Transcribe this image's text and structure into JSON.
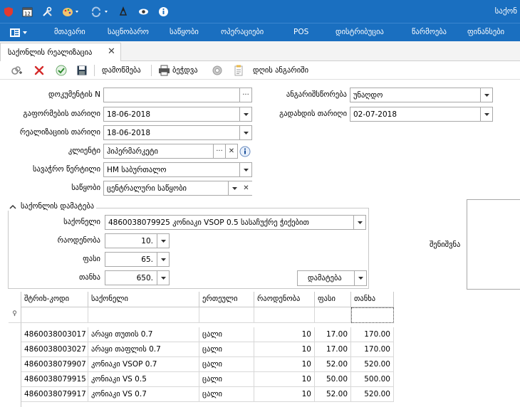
{
  "app": {
    "title": "საქონ"
  },
  "menu": {
    "items": [
      "მთავარი",
      "საცნობარო",
      "საწყობი",
      "ოპერაციები",
      "POS",
      "დისტრიბუცია",
      "წარმოება",
      "ფინანსები"
    ]
  },
  "tab": {
    "label": "საქონლის რეალიზაცია",
    "close": "✕"
  },
  "toolbar": {
    "confirm_label": "დამოწმება",
    "print_label": "ბეჭდვა",
    "report_label": "დღის ანგარიში"
  },
  "form": {
    "doc_number": {
      "label": "დოკუმენტის N",
      "value": "",
      "btn": "···"
    },
    "account_type": {
      "label": "ანგარიშსწორება",
      "value": "უნაღდო"
    },
    "issue_date": {
      "label": "გაფორმების თარიღი",
      "value": "18-06-2018"
    },
    "pay_date": {
      "label": "გადახდის თარიღი",
      "value": "02-07-2018"
    },
    "sale_date": {
      "label": "რეალიზაციის თარიღი",
      "value": "18-06-2018"
    },
    "client": {
      "label": "კლიენტი",
      "value": "ჰიპერმარკეტი",
      "btn": "···",
      "clear": "✕"
    },
    "price_list": {
      "label": "სავაჭრო წერტილი",
      "value": "HM საბურთალო"
    },
    "warehouse": {
      "label": "საწყობი",
      "value": "ცენტრალური საწყობი",
      "clear": "✕"
    }
  },
  "add_group": {
    "title": "საქონლის დამატება",
    "product": {
      "label": "საქონელი",
      "value": "4860038079925  კონიაკი VSOP 0.5 სასაჩუქრე ჭიქებით"
    },
    "quantity": {
      "label": "რაოდენობა",
      "value": "10."
    },
    "price": {
      "label": "ფასი",
      "value": "65."
    },
    "amount": {
      "label": "თანხა",
      "value": "650."
    },
    "add_button": "დამატება"
  },
  "notes": {
    "label": "შენიშვნა"
  },
  "grid": {
    "columns": [
      "შტრიხ-კოდი",
      "საქონელი",
      "ერთეული",
      "რაოდენობა",
      "ფასი",
      "თანხა"
    ],
    "filter_icon": "♀",
    "rows": [
      [
        "4860038003017",
        "არაყი თუთის 0.7",
        "ცალი",
        "10",
        "17.00",
        "170.00"
      ],
      [
        "4860038003027",
        "არაყი თაფლის 0.7",
        "ცალი",
        "10",
        "17.00",
        "170.00"
      ],
      [
        "4860038079907",
        "კონიაკი VSOP 0.7",
        "ცალი",
        "10",
        "52.00",
        "520.00"
      ],
      [
        "4860038079915",
        "კონიაკი VS 0.5",
        "ცალი",
        "10",
        "50.00",
        "500.00"
      ],
      [
        "4860038079917",
        "კონიაკი VS 0.7",
        "ცალი",
        "10",
        "52.00",
        "520.00"
      ]
    ]
  },
  "colors": {
    "accent": "#1a6fc0",
    "grid_line": "#d8d8d8"
  },
  "icons": [
    "shield-icon",
    "calendar-icon",
    "tools-icon",
    "palette-icon",
    "sync-icon",
    "user-icon",
    "eye-icon",
    "info-icon",
    "menu-icon",
    "add-icon",
    "delete-icon",
    "check-icon",
    "save-icon",
    "printer-icon",
    "settings-icon",
    "report-icon"
  ]
}
